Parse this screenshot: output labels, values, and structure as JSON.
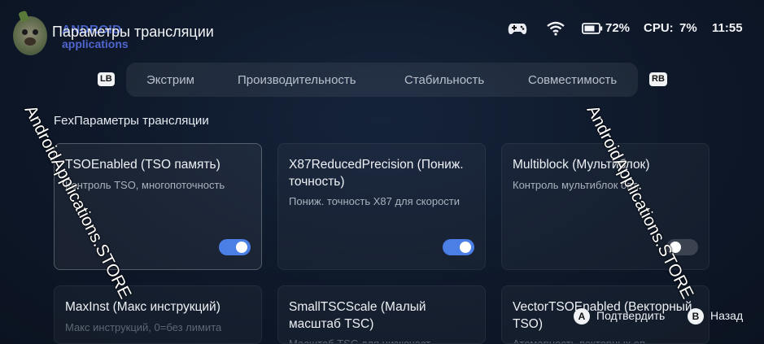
{
  "header": {
    "title": "Параметры трансляции",
    "brand_line1": "ANDROID",
    "brand_line2": "applications"
  },
  "status": {
    "battery": "72%",
    "cpu_label": "CPU:",
    "cpu_value": "7%",
    "time": "11:55"
  },
  "tabs": {
    "lb": "LB",
    "rb": "RB",
    "items": [
      "Экстрим",
      "Производительность",
      "Стабильность",
      "Совместимость"
    ]
  },
  "section_title": "FexПараметры трансляции",
  "cards": [
    {
      "title": "TSOEnabled (TSO память)",
      "desc": "Контроль TSO, многопоточность",
      "toggle": "on"
    },
    {
      "title": "X87ReducedPrecision (Пониж. точность)",
      "desc": "Пониж. точность X87 для скорости",
      "toggle": "on"
    },
    {
      "title": "Multiblock (Мультиблок)",
      "desc": "Контроль мультиблок опт.",
      "toggle": "off"
    },
    {
      "title": "MaxInst (Макс инструкций)",
      "desc": "Макс инструкций, 0=без лимита"
    },
    {
      "title": "SmallTSCScale (Малый масштаб TSC)",
      "desc": "Масштаб TSC для низкочаст..."
    },
    {
      "title": "VectorTSOEnabled (Векторный TSO)",
      "desc": "Атомарность векторных оп..."
    }
  ],
  "watermark": "AndroidApplications.STORE",
  "footer": {
    "confirm_key": "A",
    "confirm_label": "Подтвердить",
    "back_key": "B",
    "back_label": "Назад"
  }
}
